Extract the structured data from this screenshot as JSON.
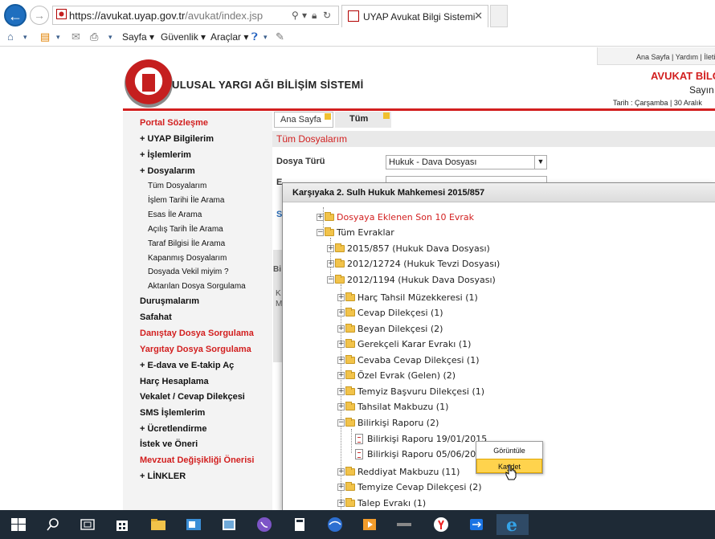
{
  "browser": {
    "url_prefix": "https://",
    "url_host": "avukat.uyap.gov.tr",
    "url_path": "/avukat/index.jsp",
    "tab_title": "UYAP Avukat Bilgi Sistemi",
    "menu": {
      "sayfa": "Sayfa",
      "guvenlik": "Güvenlik",
      "araclar": "Araçlar"
    }
  },
  "header": {
    "top_links": "Ana Sayfa | Yardım | İleti",
    "site_title": "ULUSAL YARGI AĞI BİLİŞİM SİSTEMİ",
    "avukat_title": "AVUKAT BİLGİ",
    "sayin": "Sayın",
    "tarih": "Tarih : Çarşamba | 30 Aralık"
  },
  "sidebar": {
    "items": [
      {
        "label": "Portal Sözleşme"
      },
      {
        "label": "+ UYAP Bilgilerim"
      },
      {
        "label": "+ İşlemlerim"
      },
      {
        "label": "+ Dosyalarım"
      },
      {
        "label": "Tüm Dosyalarım"
      },
      {
        "label": "İşlem Tarihi İle Arama"
      },
      {
        "label": "Esas İle Arama"
      },
      {
        "label": "Açılış Tarih İle Arama"
      },
      {
        "label": "Taraf Bilgisi İle Arama"
      },
      {
        "label": "Kapanmış Dosyalarım"
      },
      {
        "label": "Dosyada Vekil miyim ?"
      },
      {
        "label": "Aktarılan Dosya Sorgulama"
      },
      {
        "label": "Duruşmalarım"
      },
      {
        "label": "Safahat"
      },
      {
        "label": "Danıştay Dosya Sorgulama"
      },
      {
        "label": "Yargıtay Dosya Sorgulama"
      },
      {
        "label": "+ E-dava ve E-takip Aç"
      },
      {
        "label": "Harç Hesaplama"
      },
      {
        "label": "Vekalet / Cevap Dilekçesi"
      },
      {
        "label": "SMS İşlemlerim"
      },
      {
        "label": "+ Ücretlendirme"
      },
      {
        "label": "İstek ve Öneri"
      },
      {
        "label": "Mevzuat Değişikliği Önerisi"
      },
      {
        "label": "+ LİNKLER"
      }
    ]
  },
  "content": {
    "tab_ana": "Ana Sayfa",
    "tab_tum": "Tüm",
    "title": "Tüm Dosyalarım",
    "dosya_turu_label": "Dosya Türü",
    "dosya_turu_value": "Hukuk - Dava Dosyası",
    "e_label": "E",
    "s_label": "S",
    "bi_label": "Bi",
    "k_label": "K",
    "m_label": "M"
  },
  "modal": {
    "title": "Karşıyaka 2. Sulh Hukuk Mahkemesi 2015/857",
    "tree": [
      {
        "label": "Dosyaya Eklenen Son 10 Evrak"
      },
      {
        "label": "Tüm Evraklar"
      },
      {
        "label": "2015/857 (Hukuk Dava Dosyası)"
      },
      {
        "label": "2012/12724 (Hukuk Tevzi Dosyası)"
      },
      {
        "label": "2012/1194 (Hukuk Dava Dosyası)"
      },
      {
        "label": "Harç Tahsil Müzekkeresi (1)"
      },
      {
        "label": "Cevap Dilekçesi (1)"
      },
      {
        "label": "Beyan Dilekçesi (2)"
      },
      {
        "label": "Gerekçeli Karar Evrakı (1)"
      },
      {
        "label": "Cevaba Cevap Dilekçesi (1)"
      },
      {
        "label": "Özel Evrak (Gelen) (2)"
      },
      {
        "label": "Temyiz Başvuru Dilekçesi (1)"
      },
      {
        "label": "Tahsilat Makbuzu (1)"
      },
      {
        "label": "Bilirkişi Raporu (2)"
      },
      {
        "label": "Bilirkişi Raporu 19/01/2015"
      },
      {
        "label": "Bilirkişi Raporu 05/06/2013"
      },
      {
        "label": "Reddiyat Makbuzu (11)"
      },
      {
        "label": "Temyize Cevap Dilekçesi (2)"
      },
      {
        "label": "Talep Evrakı (1)"
      }
    ]
  },
  "context_menu": {
    "item1": "Görüntüle",
    "item2": "Kaydet"
  },
  "colors": {
    "accent_red": "#d21f1f",
    "ie_blue": "#1f6fbf",
    "taskbar": "#1e2a36"
  }
}
